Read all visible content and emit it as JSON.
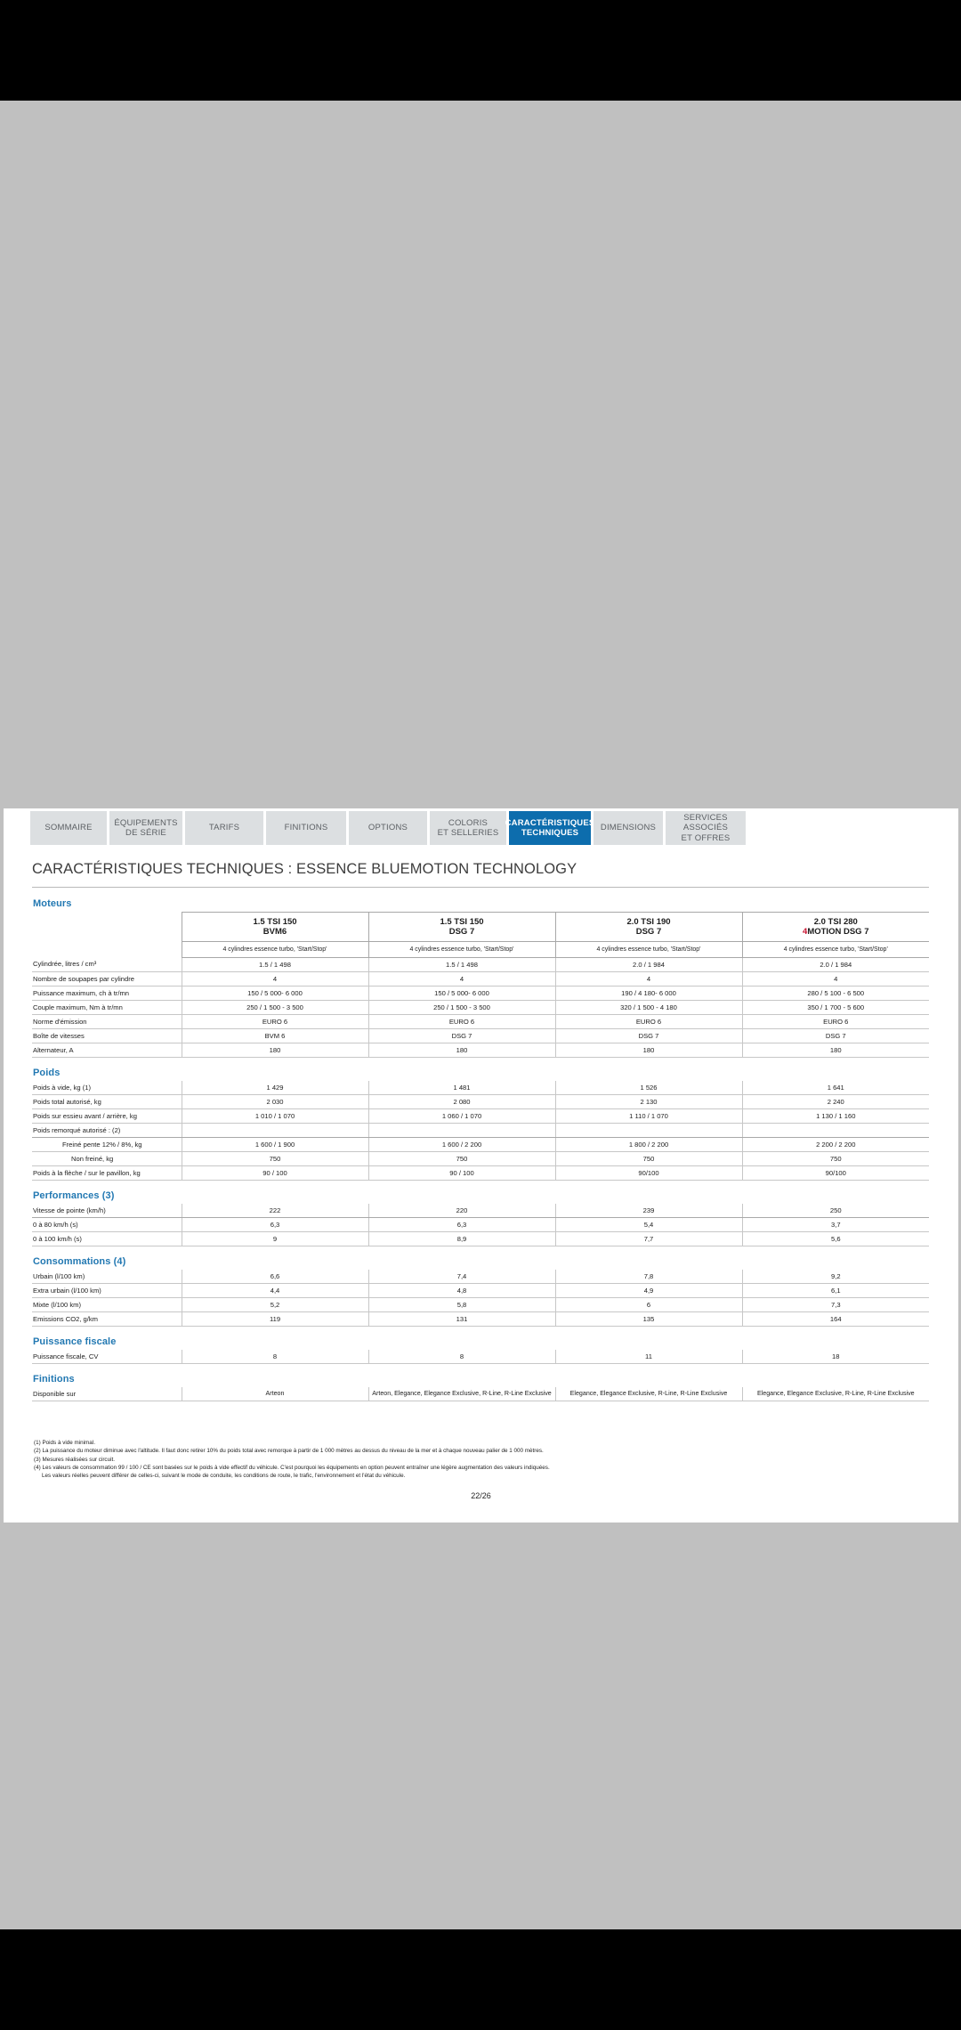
{
  "tabs": [
    {
      "label": "SOMMAIRE",
      "active": false
    },
    {
      "label": "ÉQUIPEMENTS\nDE SÉRIE",
      "active": false
    },
    {
      "label": "TARIFS",
      "active": false
    },
    {
      "label": "FINITIONS",
      "active": false
    },
    {
      "label": "OPTIONS",
      "active": false
    },
    {
      "label": "COLORIS\nET SELLERIES",
      "active": false
    },
    {
      "label": "CARACTÉRISTIQUES\nTECHNIQUES",
      "active": true
    },
    {
      "label": "DIMENSIONS",
      "active": false
    },
    {
      "label": "SERVICES ASSOCIÉS\nET OFFRES",
      "active": false
    }
  ],
  "page": {
    "title": "CARACTÉRISTIQUES TECHNIQUES : ESSENCE BLUEMOTION TECHNOLOGY",
    "number": "22/26"
  },
  "colors": {
    "accent_blue": "#2278b2",
    "tab_active": "#0d6dad",
    "four_motion_red": "#c8102e",
    "page_background": "#ffffff",
    "viewer_background": "#c0c0c0"
  },
  "columns": {
    "engines": [
      {
        "name": "1.5 TSI 150",
        "gearbox": "BVM6",
        "four_motion": false,
        "caption": "4 cylindres essence turbo, 'Start/Stop'"
      },
      {
        "name": "1.5 TSI 150",
        "gearbox": "DSG 7",
        "four_motion": false,
        "caption": "4 cylindres essence turbo, 'Start/Stop'"
      },
      {
        "name": "2.0 TSI 190",
        "gearbox": "DSG 7",
        "four_motion": false,
        "caption": "4 cylindres essence turbo, 'Start/Stop'"
      },
      {
        "name": "2.0 TSI 280",
        "gearbox": "MOTION DSG 7",
        "four_motion": true,
        "four_prefix": "4",
        "caption": "4 cylindres essence turbo, 'Start/Stop'"
      }
    ]
  },
  "sections": [
    {
      "title": "Moteurs",
      "rows": [
        {
          "label": "Cylindrée, litres / cm³",
          "values": [
            "1.5 / 1 498",
            "1.5 / 1 498",
            "2.0 / 1 984",
            "2.0 / 1 984"
          ]
        },
        {
          "label": "Nombre de soupapes par cylindre",
          "values": [
            "4",
            "4",
            "4",
            "4"
          ]
        },
        {
          "label": "Puissance maximum, ch à tr/mn",
          "values": [
            "150 / 5 000- 6 000",
            "150 / 5 000- 6 000",
            "190 / 4 180- 6 000",
            "280 / 5 100 - 6 500"
          ]
        },
        {
          "label": "Couple maximum, Nm à tr/mn",
          "values": [
            "250 / 1 500 - 3 500",
            "250 / 1 500 - 3 500",
            "320 / 1 500 - 4 180",
            "350 / 1 700 - 5 600"
          ]
        },
        {
          "label": "Norme d'émission",
          "values": [
            "EURO 6",
            "EURO 6",
            "EURO 6",
            "EURO 6"
          ]
        },
        {
          "label": "Boîte de vitesses",
          "values": [
            "BVM 6",
            "DSG 7",
            "DSG 7",
            "DSG 7"
          ]
        },
        {
          "label": "Alternateur, A",
          "values": [
            "180",
            "180",
            "180",
            "180"
          ]
        }
      ]
    },
    {
      "title": "Poids",
      "rows": [
        {
          "label": "Poids à vide, kg (1)",
          "values": [
            "1 429",
            "1 481",
            "1 526",
            "1 641"
          ]
        },
        {
          "label": "Poids total autorisé, kg",
          "values": [
            "2 030",
            "2 080",
            "2 130",
            "2 240"
          ]
        },
        {
          "label": "Poids sur essieu avant / arrière, kg",
          "values": [
            "1 010 / 1 070",
            "1 060 / 1 070",
            "1 110 / 1 070",
            "1 130 / 1 160"
          ]
        },
        {
          "label": "Poids remorqué autorisé : (2)",
          "values": [
            "",
            "",
            "",
            ""
          ],
          "thick": true
        },
        {
          "label": "Freiné pente 12% / 8%, kg",
          "indent": 1,
          "values": [
            "1 600 / 1 900",
            "1 600 / 2 200",
            "1 800 / 2 200",
            "2 200 / 2 200"
          ]
        },
        {
          "label": "Non freiné, kg",
          "indent": 2,
          "values": [
            "750",
            "750",
            "750",
            "750"
          ]
        },
        {
          "label": "Poids à la flèche / sur le pavillon, kg",
          "values": [
            "90 / 100",
            "90 / 100",
            "90/100",
            "90/100"
          ]
        }
      ]
    },
    {
      "title": "Performances (3)",
      "rows": [
        {
          "label": "Vitesse de pointe (km/h)",
          "values": [
            "222",
            "220",
            "239",
            "250"
          ],
          "thick": true
        },
        {
          "label": "0 à 80 km/h (s)",
          "values": [
            "6,3",
            "6,3",
            "5,4",
            "3,7"
          ]
        },
        {
          "label": "0 à 100 km/h (s)",
          "values": [
            "9",
            "8,9",
            "7,7",
            "5,6"
          ]
        }
      ]
    },
    {
      "title": "Consommations (4)",
      "rows": [
        {
          "label": "Urbain (l/100 km)",
          "values": [
            "6,6",
            "7,4",
            "7,8",
            "9,2"
          ]
        },
        {
          "label": "Extra urbain (l/100 km)",
          "values": [
            "4,4",
            "4,8",
            "4,9",
            "6,1"
          ]
        },
        {
          "label": "Mixte (l/100 km)",
          "values": [
            "5,2",
            "5,8",
            "6",
            "7,3"
          ]
        },
        {
          "label": "Emissions CO2, g/km",
          "values": [
            "119",
            "131",
            "135",
            "164"
          ]
        }
      ]
    },
    {
      "title": "Puissance fiscale",
      "rows": [
        {
          "label": "Puissance fiscale, CV",
          "values": [
            "8",
            "8",
            "11",
            "18"
          ]
        }
      ]
    },
    {
      "title": "Finitions",
      "rows": [
        {
          "label": "Disponible sur",
          "multi": true,
          "values": [
            "Arteon",
            "Arteon, Elegance, Elegance Exclusive, R-Line, R-Line Exclusive",
            "Elegance, Elegance Exclusive, R-Line, R-Line Exclusive",
            "Elegance, Elegance Exclusive, R-Line, R-Line Exclusive"
          ]
        }
      ]
    }
  ],
  "footnotes": [
    {
      "text": "(1) Poids à vide minimal.",
      "cont": false
    },
    {
      "text": "(2) La puissance du moteur diminue avec l'altitude. Il faut donc retirer 10% du poids total avec remorque à partir de 1 000 mètres au dessus du niveau de la mer et à chaque nouveau palier de 1 000 mètres.",
      "cont": false
    },
    {
      "text": "(3) Mesures réalisées sur circuit.",
      "cont": false
    },
    {
      "text": "(4) Les valeurs de consommation 99 / 100 / CE sont basées sur le poids à vide effectif du véhicule. C'est pourquoi les équipements en option peuvent entraîner une légère augmentation des valeurs indiquées.",
      "cont": false
    },
    {
      "text": "Les valeurs réelles peuvent différer de celles-ci, suivant le mode de conduite, les conditions de route, le trafic, l'environnement et l'état du véhicule.",
      "cont": true
    }
  ]
}
